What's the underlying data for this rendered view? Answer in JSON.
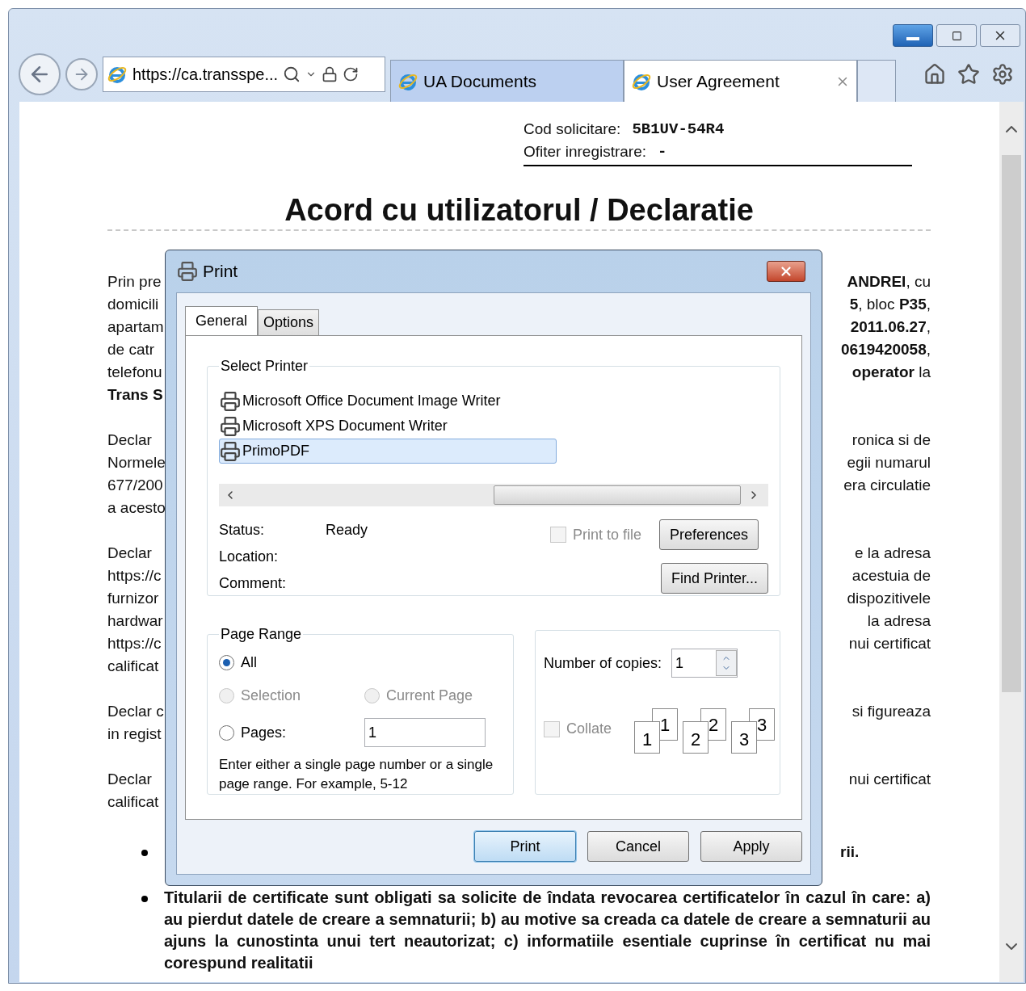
{
  "browser": {
    "address": "https://ca.transspe...",
    "tabs": [
      {
        "label": "UA Documents",
        "selected": false
      },
      {
        "label": "User Agreement",
        "selected": true
      }
    ]
  },
  "document": {
    "header": [
      {
        "label": "Cod solicitare:",
        "value": "5B1UV-54R4"
      },
      {
        "label": "Ofiter inregistrare:",
        "value": "-"
      }
    ],
    "title": "Acord cu utilizatorul / Declaratie",
    "paragraphs": [
      {
        "lines": [
          {
            "left": "Prin pre",
            "right": "**ANDREI**, cu"
          },
          {
            "left": "domicili",
            "right": "**5**, bloc **P35**,"
          },
          {
            "left": "apartam",
            "right": "**2011.06.27**,"
          },
          {
            "left": "de catr",
            "right": "**0619420058**,"
          },
          {
            "left": "telefonu",
            "right": "**operator** la"
          },
          {
            "left": "**Trans S**"
          }
        ]
      },
      {
        "lines": [
          {
            "left": "Declar",
            "right": "ronica si de"
          },
          {
            "left": "Normele",
            "right": "egii numarul"
          },
          {
            "left": "677/200",
            "right": "era circulatie"
          },
          {
            "left": "a acesto"
          }
        ]
      },
      {
        "lines": [
          {
            "left": "Declar",
            "right": "e la adresa"
          },
          {
            "left": "https://c",
            "right": "acestuia de"
          },
          {
            "left": "furnizor",
            "right": "dispozitivele"
          },
          {
            "left": "hardwar",
            "right": "la adresa"
          },
          {
            "left": "https://c",
            "right": "nui certificat"
          },
          {
            "left": "calificat"
          }
        ]
      },
      {
        "lines": [
          {
            "left": "Declar c",
            "right": "si figureaza"
          },
          {
            "left": "in regist"
          }
        ]
      },
      {
        "lines": [
          {
            "left": "Declar",
            "right": "nui certificat"
          },
          {
            "left": "calificat"
          }
        ]
      }
    ],
    "bullets": [
      {
        "tail": "rii."
      },
      {
        "text": "Titularii de certificate sunt obligati sa solicite de îndata revocarea certificatelor în cazul în care: a) au pierdut datele de creare a semnaturii; b) au motive sa creada ca datele de creare a semnaturii au ajuns la cunostinta unui tert neautorizat; c) informatiile esentiale cuprinse în certificat nu mai corespund realitatii"
      }
    ]
  },
  "print_dialog": {
    "title": "Print",
    "tabs": [
      {
        "label": "General",
        "selected": true
      },
      {
        "label": "Options",
        "selected": false
      }
    ],
    "select_printer": {
      "legend": "Select Printer",
      "printers": [
        {
          "name": "Microsoft Office Document Image Writer",
          "selected": false
        },
        {
          "name": "Microsoft XPS Document Writer",
          "selected": false
        },
        {
          "name": "PrimoPDF",
          "selected": true
        }
      ]
    },
    "status": [
      {
        "label": "Status:",
        "value": "Ready"
      },
      {
        "label": "Location:"
      },
      {
        "label": "Comment:"
      }
    ],
    "print_to_file": {
      "label": "Print to file",
      "checked": false,
      "disabled": true
    },
    "side_buttons": [
      "Preferences",
      "Find Printer..."
    ],
    "page_range": {
      "legend": "Page Range",
      "options": [
        {
          "label": "All",
          "selected": true,
          "disabled": false
        },
        {
          "label": "Selection",
          "selected": false,
          "disabled": true
        },
        {
          "label": "Current Page",
          "selected": false,
          "disabled": true
        },
        {
          "label": "Pages:",
          "selected": false,
          "disabled": false
        }
      ],
      "pages_value": "1",
      "hint": "Enter either a single page number or a single page range.  For example, 5-12"
    },
    "copies": {
      "label": "Number of copies:",
      "value": "1",
      "collate": {
        "label": "Collate",
        "checked": false,
        "disabled": true
      },
      "pages": [
        {
          "back": "1",
          "front": "1"
        },
        {
          "back": "2",
          "front": "2"
        },
        {
          "back": "3",
          "front": "3"
        }
      ]
    },
    "buttons": [
      {
        "label": "Print",
        "default": true
      },
      {
        "label": "Cancel",
        "default": false
      },
      {
        "label": "Apply",
        "default": false
      }
    ]
  }
}
